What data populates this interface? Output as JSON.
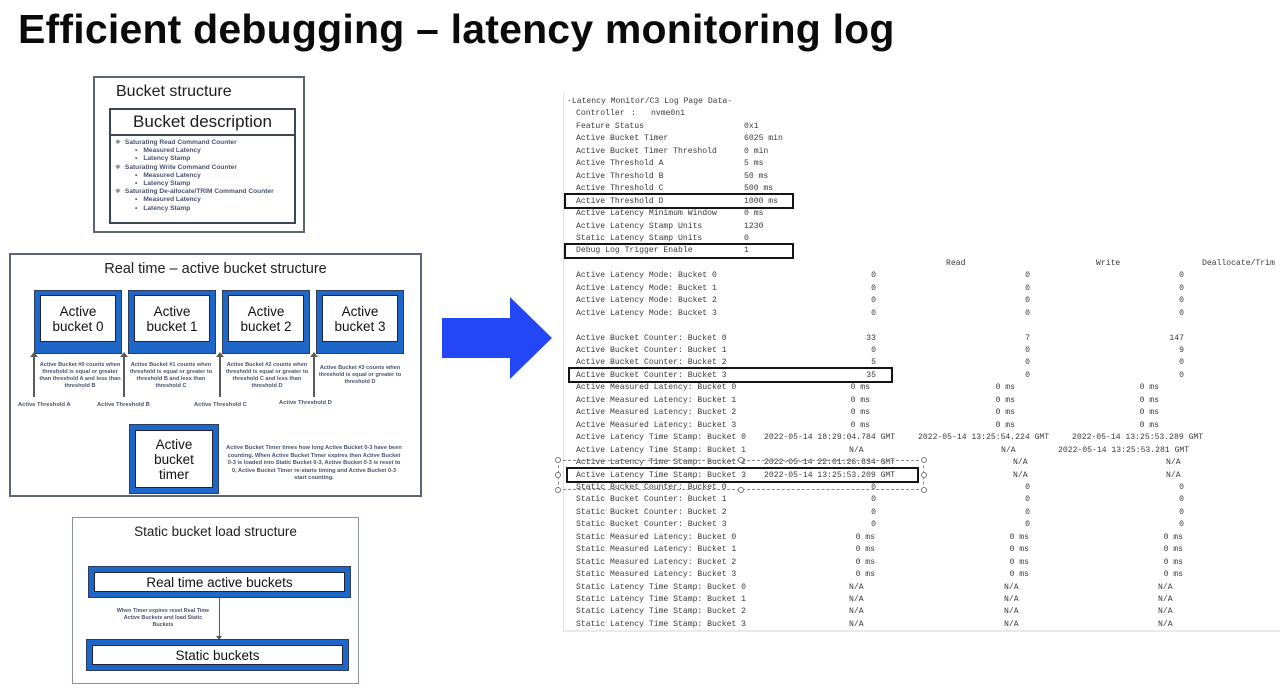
{
  "title": "Efficient debugging – latency monitoring log",
  "bucket_structure": {
    "title": "Bucket structure",
    "description_header": "Bucket description",
    "items": [
      {
        "level": 1,
        "bullet": "❖",
        "text": "Saturating Read Command Counter"
      },
      {
        "level": 2,
        "bullet": "•",
        "text": "Measured Latency"
      },
      {
        "level": 2,
        "bullet": "•",
        "text": "Latency Stamp"
      },
      {
        "level": 1,
        "bullet": "❖",
        "text": "Saturating Write Command Counter"
      },
      {
        "level": 2,
        "bullet": "•",
        "text": "Measured Latency"
      },
      {
        "level": 2,
        "bullet": "•",
        "text": "Latency Stamp"
      },
      {
        "level": 1,
        "bullet": "❖",
        "text": "Saturating De-allocate/TRIM Command Counter"
      },
      {
        "level": 2,
        "bullet": "•",
        "text": "Measured Latency"
      },
      {
        "level": 2,
        "bullet": "•",
        "text": "Latency Stamp"
      }
    ]
  },
  "realtime": {
    "title": "Real time – active bucket structure",
    "buckets": [
      {
        "label": "Active bucket 0",
        "note": "Active Bucket #0 counts when threshold is equal or greater than threshold A and less than threshold B"
      },
      {
        "label": "Active bucket 1",
        "note": "Active Bucket #1 counts when threshold is equal or greater to threshold B and less than threshold C"
      },
      {
        "label": "Active bucket 2",
        "note": "Active Bucket #2 counts when threshold is equal or greater to threshold C and less than threshold D"
      },
      {
        "label": "Active bucket 3",
        "note": "Active Bucket #3 counts when threshold is equal or greater to threshold D"
      }
    ],
    "thresholds": [
      "Active Threshold A",
      "Active Threshold B",
      "Active Threshold C",
      "Active Threshold D"
    ],
    "timer": {
      "label": "Active bucket timer",
      "note": "Active Bucket Timer times how long Active Bucket 0-3 have been counting.  When Active Bucket Timer expires then Active Bucket 0-3 is loaded into Static Bucket 0-3, Active Bucket 0-3 is reset to 0, Active Bucket Timer re-starts timing and Active Bucket 0-3 start counting."
    }
  },
  "static_load": {
    "title": "Static bucket load structure",
    "top_box": "Real time active buckets",
    "bottom_box": "Static buckets",
    "note": "When Timer expires reset Real Time Active Buckets and load Static Buckets"
  },
  "arrow_color": "#2447f5",
  "log": {
    "header": "-Latency Monitor/C3 Log Page Data-",
    "controller_label": "Controller",
    "controller_sep": ":",
    "controller_value": "nvme0n1",
    "settings": [
      {
        "label": "Feature Status",
        "value": "0x1"
      },
      {
        "label": "Active Bucket Timer",
        "value": "6025 min"
      },
      {
        "label": "Active Bucket Timer Threshold",
        "value": "0 min"
      },
      {
        "label": "Active Threshold A",
        "value": "5 ms"
      },
      {
        "label": "Active Threshold B",
        "value": "50 ms"
      },
      {
        "label": "Active Threshold C",
        "value": "500 ms"
      },
      {
        "label": "Active Threshold D",
        "value": "1000 ms",
        "highlighted": true
      },
      {
        "label": "Active Latency Minimum Window",
        "value": "0 ms"
      },
      {
        "label": "Active Latency Stamp Units",
        "value": "1230"
      },
      {
        "label": "Static Latency Stamp Units",
        "value": "0"
      },
      {
        "label": "Debug Log Trigger Enable",
        "value": "1",
        "highlighted": true
      }
    ],
    "columns": [
      "Read",
      "Write",
      "Deallocate/Trim"
    ],
    "groups": [
      {
        "kind": "int",
        "rows": [
          {
            "label": "Active Latency Mode: Bucket 0",
            "values": [
              "0",
              "0",
              "0"
            ]
          },
          {
            "label": "Active Latency Mode: Bucket 1",
            "values": [
              "0",
              "0",
              "0"
            ]
          },
          {
            "label": "Active Latency Mode: Bucket 2",
            "values": [
              "0",
              "0",
              "0"
            ]
          },
          {
            "label": "Active Latency Mode: Bucket 3",
            "values": [
              "0",
              "0",
              "0"
            ]
          }
        ]
      },
      {
        "kind": "int",
        "gap_before": true,
        "rows": [
          {
            "label": "Active Bucket Counter: Bucket 0",
            "values": [
              "33",
              "7",
              "147"
            ]
          },
          {
            "label": "Active Bucket Counter: Bucket 1",
            "values": [
              "0",
              "0",
              "9"
            ]
          },
          {
            "label": "Active Bucket Counter: Bucket 2",
            "values": [
              "5",
              "0",
              "0"
            ]
          },
          {
            "label": "Active Bucket Counter: Bucket 3",
            "values": [
              "35",
              "0",
              "0"
            ],
            "highlighted": true
          }
        ]
      },
      {
        "kind": "ms",
        "rows": [
          {
            "label": "Active Measured Latency: Bucket 0",
            "values": [
              "0 ms",
              "0 ms",
              "0 ms"
            ]
          },
          {
            "label": "Active Measured Latency: Bucket 1",
            "values": [
              "0 ms",
              "0 ms",
              "0 ms"
            ]
          },
          {
            "label": "Active Measured Latency: Bucket 2",
            "values": [
              "0 ms",
              "0 ms",
              "0 ms"
            ]
          },
          {
            "label": "Active Measured Latency: Bucket 3",
            "values": [
              "0 ms",
              "0 ms",
              "0 ms"
            ]
          }
        ]
      },
      {
        "kind": "ts",
        "rows": [
          {
            "label": "Active Latency Time Stamp: Bucket 0",
            "values": [
              "2022-05-14 18:29:04.784 GMT",
              "2022-05-14 13:25:54.224 GMT",
              "2022-05-14 13:25:53.289 GMT"
            ]
          },
          {
            "label": "Active Latency Time Stamp: Bucket 1",
            "values": [
              "N/A",
              "N/A",
              "2022-05-14 13:25:53.281 GMT"
            ]
          },
          {
            "label": "Active Latency Time Stamp: Bucket 2",
            "values": [
              "2022-05-14 22:01:26.834 GMT",
              "N/A",
              "N/A"
            ]
          },
          {
            "label": "Active Latency Time Stamp: Bucket 3",
            "values": [
              "2022-05-14 13:25:53.209 GMT",
              "N/A",
              "N/A"
            ],
            "highlighted": true
          }
        ]
      },
      {
        "kind": "int",
        "rows": [
          {
            "label": "Static Bucket Counter: Bucket 0",
            "values": [
              "0",
              "0",
              "0"
            ]
          },
          {
            "label": "Static Bucket Counter: Bucket 1",
            "values": [
              "0",
              "0",
              "0"
            ]
          },
          {
            "label": "Static Bucket Counter: Bucket 2",
            "values": [
              "0",
              "0",
              "0"
            ]
          },
          {
            "label": "Static Bucket Counter: Bucket 3",
            "values": [
              "0",
              "0",
              "0"
            ]
          }
        ]
      },
      {
        "kind": "sms",
        "rows": [
          {
            "label": "Static Measured Latency: Bucket 0",
            "values": [
              "0 ms",
              "0 ms",
              "0 ms"
            ]
          },
          {
            "label": "Static Measured Latency: Bucket 1",
            "values": [
              "0 ms",
              "0 ms",
              "0 ms"
            ]
          },
          {
            "label": "Static Measured Latency: Bucket 2",
            "values": [
              "0 ms",
              "0 ms",
              "0 ms"
            ]
          },
          {
            "label": "Static Measured Latency: Bucket 3",
            "values": [
              "0 ms",
              "0 ms",
              "0 ms"
            ]
          }
        ]
      },
      {
        "kind": "sna",
        "rows": [
          {
            "label": "Static Latency Time Stamp: Bucket 0",
            "values": [
              "N/A",
              "N/A",
              "N/A"
            ]
          },
          {
            "label": "Static Latency Time Stamp: Bucket 1",
            "values": [
              "N/A",
              "N/A",
              "N/A"
            ]
          },
          {
            "label": "Static Latency Time Stamp: Bucket 2",
            "values": [
              "N/A",
              "N/A",
              "N/A"
            ]
          },
          {
            "label": "Static Latency Time Stamp: Bucket 3",
            "values": [
              "N/A",
              "N/A",
              "N/A"
            ]
          }
        ]
      }
    ]
  }
}
